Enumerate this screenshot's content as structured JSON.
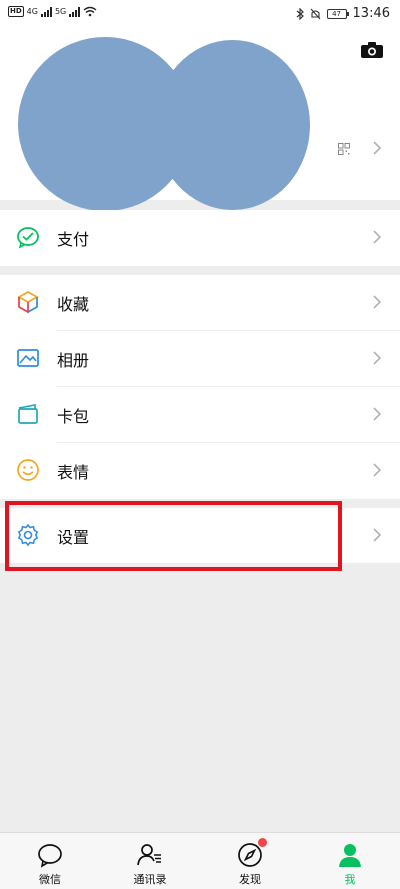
{
  "status_bar": {
    "hd_label": "HD",
    "network_a": "4G",
    "network_b": "5G",
    "battery": "47",
    "time": "13:46"
  },
  "menu": {
    "pay_label": "支付",
    "favorites_label": "收藏",
    "album_label": "相册",
    "cards_label": "卡包",
    "stickers_label": "表情",
    "settings_label": "设置"
  },
  "tabbar": {
    "chats_label": "微信",
    "contacts_label": "通讯录",
    "discover_label": "发现",
    "me_label": "我"
  },
  "colors": {
    "accent": "#07c160",
    "highlight_border": "#e0151f",
    "redaction_blob": "#7fa3cb",
    "badge_dot": "#f0454a"
  }
}
